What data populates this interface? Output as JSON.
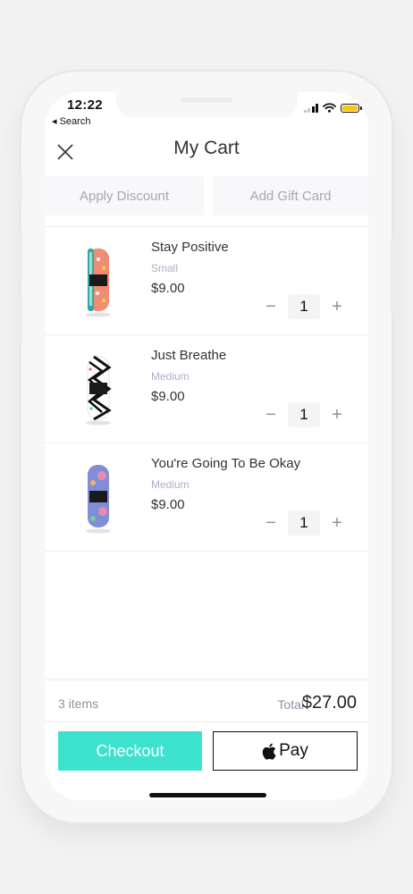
{
  "status_bar": {
    "time": "12:22",
    "back_label": "◂ Search"
  },
  "header": {
    "title": "My Cart"
  },
  "actions": {
    "discount_label": "Apply Discount",
    "gift_card_label": "Add Gift Card"
  },
  "cart_items": [
    {
      "name": "Stay Positive",
      "size": "Small",
      "price": "$9.00",
      "quantity": "1"
    },
    {
      "name": "Just Breathe",
      "size": "Medium",
      "price": "$9.00",
      "quantity": "1"
    },
    {
      "name": "You're Going To Be Okay",
      "size": "Medium",
      "price": "$9.00",
      "quantity": "1"
    }
  ],
  "summary": {
    "items_count": "3 items",
    "total_label": "Total",
    "total_value": "$27.00"
  },
  "buttons": {
    "checkout_label": "Checkout",
    "pay_label": "Pay"
  },
  "stepper": {
    "minus": "−",
    "plus": "+"
  },
  "colors": {
    "checkout": "#3de2cf",
    "muted_text": "#a4a8b3",
    "battery": "#f5c518"
  },
  "icons": {
    "close": "close-icon",
    "apple": "apple-icon",
    "wifi": "wifi-icon",
    "battery": "battery-icon",
    "signal": "signal-icon"
  }
}
